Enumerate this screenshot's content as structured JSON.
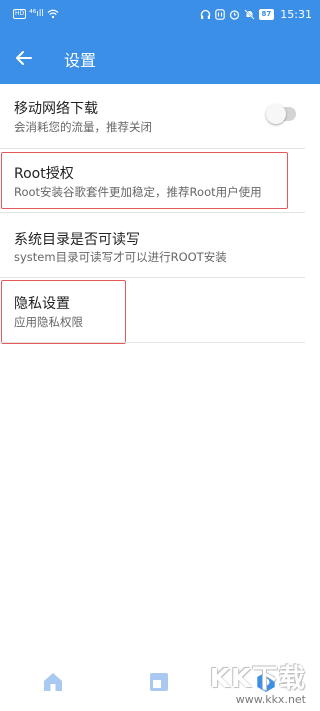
{
  "status_bar": {
    "network_badge": "HD",
    "signal": "⁴⁶ıll",
    "battery_level": "87",
    "time": "15:31"
  },
  "header": {
    "title": "设置"
  },
  "settings": [
    {
      "title": "移动网络下载",
      "subtitle": "会消耗您的流量，推荐关闭",
      "has_toggle": true,
      "toggle_on": false
    },
    {
      "title": "Root授权",
      "subtitle": "Root安装谷歌套件更加稳定，推荐Root用户使用",
      "highlighted": true
    },
    {
      "title": "系统目录是否可读写",
      "subtitle": "system目录可读写才可以进行ROOT安装"
    },
    {
      "title": "隐私设置",
      "subtitle": "应用隐私权限",
      "highlighted": true
    }
  ],
  "bottom_nav": {
    "items": [
      "home-icon",
      "document-icon",
      "settings-icon"
    ],
    "active": "settings-icon"
  },
  "watermark": {
    "logo": "KK下载",
    "url": "www.kkx.net"
  },
  "colors": {
    "primary": "#3c8fe6",
    "nav_inactive": "#a9c9f2",
    "highlight_border": "#e45a5a"
  }
}
